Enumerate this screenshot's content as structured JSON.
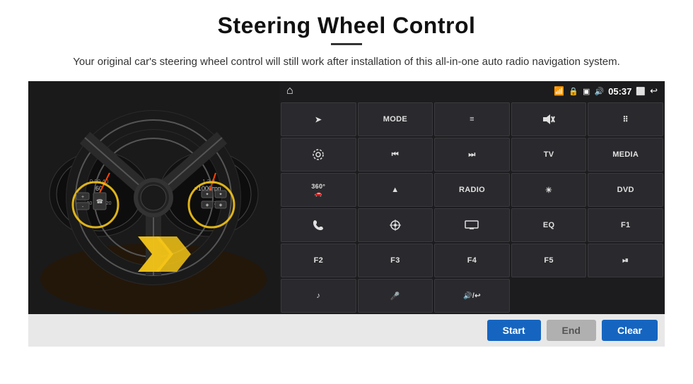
{
  "header": {
    "title": "Steering Wheel Control",
    "subtitle": "Your original car's steering wheel control will still work after installation of this all-in-one auto radio navigation system."
  },
  "statusBar": {
    "home_icon": "⌂",
    "time": "05:37",
    "back_icon": "↩"
  },
  "buttons": [
    {
      "id": "row1",
      "cells": [
        {
          "label": "➤",
          "type": "icon"
        },
        {
          "label": "MODE",
          "type": "text"
        },
        {
          "label": "≡",
          "type": "icon"
        },
        {
          "label": "🔇",
          "type": "icon"
        },
        {
          "label": "⠿",
          "type": "icon"
        }
      ]
    },
    {
      "id": "row2",
      "cells": [
        {
          "label": "⚙",
          "type": "icon"
        },
        {
          "label": "⏮",
          "type": "icon"
        },
        {
          "label": "⏭",
          "type": "icon"
        },
        {
          "label": "TV",
          "type": "text"
        },
        {
          "label": "MEDIA",
          "type": "text"
        }
      ]
    },
    {
      "id": "row3",
      "cells": [
        {
          "label": "360°",
          "type": "text"
        },
        {
          "label": "▲",
          "type": "icon"
        },
        {
          "label": "RADIO",
          "type": "text"
        },
        {
          "label": "☀",
          "type": "icon"
        },
        {
          "label": "DVD",
          "type": "text"
        }
      ]
    },
    {
      "id": "row4",
      "cells": [
        {
          "label": "📞",
          "type": "icon"
        },
        {
          "label": "🔄",
          "type": "icon"
        },
        {
          "label": "▬",
          "type": "icon"
        },
        {
          "label": "EQ",
          "type": "text"
        },
        {
          "label": "F1",
          "type": "text"
        }
      ]
    },
    {
      "id": "row5",
      "cells": [
        {
          "label": "F2",
          "type": "text"
        },
        {
          "label": "F3",
          "type": "text"
        },
        {
          "label": "F4",
          "type": "text"
        },
        {
          "label": "F5",
          "type": "text"
        },
        {
          "label": "⏯",
          "type": "icon"
        }
      ]
    },
    {
      "id": "row6",
      "cells": [
        {
          "label": "♪",
          "type": "icon"
        },
        {
          "label": "🎤",
          "type": "icon"
        },
        {
          "label": "🔊/↩",
          "type": "icon"
        },
        {
          "label": "",
          "type": "empty"
        },
        {
          "label": "",
          "type": "empty"
        }
      ]
    }
  ],
  "actionBar": {
    "start_label": "Start",
    "end_label": "End",
    "clear_label": "Clear"
  }
}
